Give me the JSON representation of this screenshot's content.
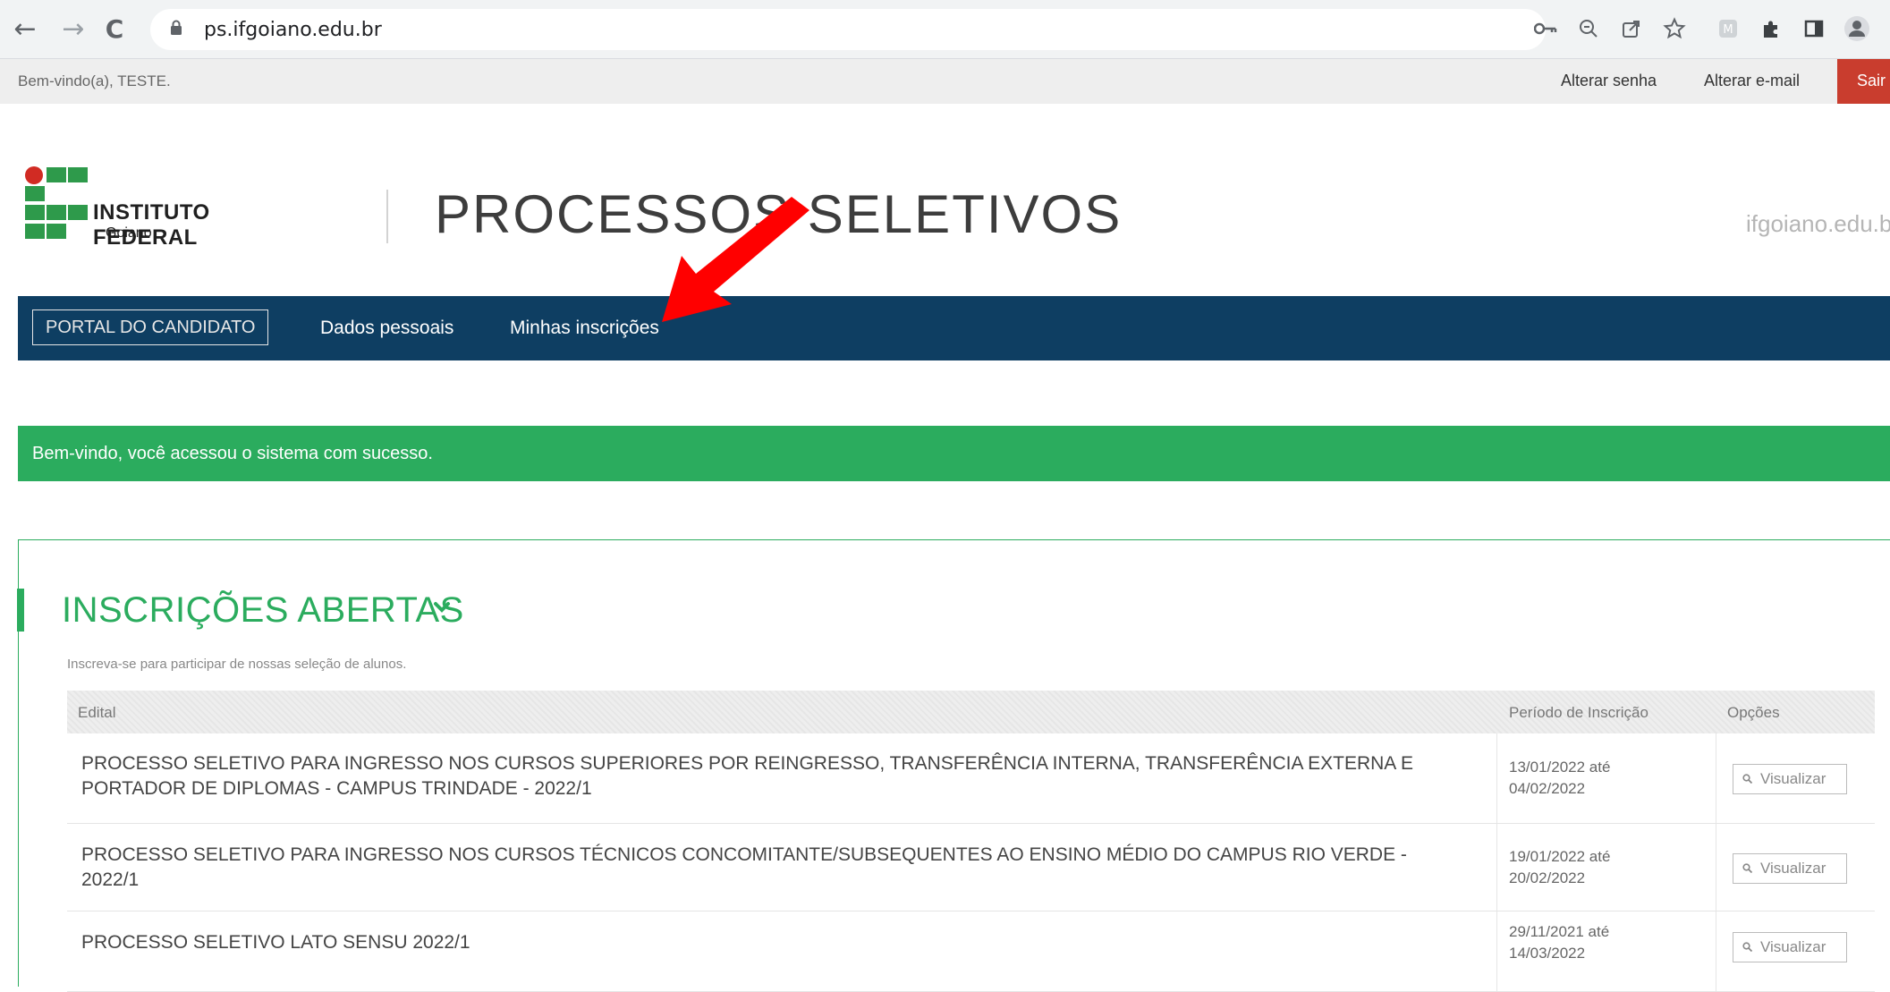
{
  "browser": {
    "url": "ps.ifgoiano.edu.br",
    "back_icon": "←",
    "forward_icon": "→",
    "reload_icon": "C",
    "icons": [
      "key-icon",
      "zoom-icon",
      "share-icon",
      "star-icon",
      "extension-m-icon",
      "puzzle-icon",
      "sidepanel-icon",
      "profile-icon"
    ]
  },
  "userbar": {
    "welcome": "Bem-vindo(a), TESTE.",
    "change_password": "Alterar senha",
    "change_email": "Alterar e-mail",
    "logout": "Sair"
  },
  "header": {
    "logo_name": "INSTITUTO FEDERAL",
    "logo_sub": "Goiano",
    "title": "PROCESSOS SELETIVOS",
    "domain": "ifgoiano.edu.b"
  },
  "nav": {
    "portal": "PORTAL DO CANDIDATO",
    "personal_data": "Dados pessoais",
    "my_registrations": "Minhas inscrições"
  },
  "alert": {
    "message": "Bem-vindo, você acessou o sistema com sucesso."
  },
  "panel": {
    "title": "INSCRIÇÕES ABERTAS",
    "subtitle": "Inscreva-se para participar de nossas seleção de alunos.",
    "columns": {
      "edital": "Edital",
      "periodo": "Período de Inscrição",
      "opcoes": "Opções"
    },
    "rows": [
      {
        "edital_line1": "PROCESSO SELETIVO PARA INGRESSO NOS CURSOS SUPERIORES POR REINGRESSO, TRANSFERÊNCIA INTERNA, TRANSFERÊNCIA EXTERNA E",
        "edital_line2": "PORTADOR DE DIPLOMAS - CAMPUS TRINDADE - 2022/1",
        "period_line1": "13/01/2022 até",
        "period_line2": "04/02/2022",
        "action": "Visualizar"
      },
      {
        "edital_line1": "PROCESSO SELETIVO PARA INGRESSO NOS CURSOS TÉCNICOS CONCOMITANTE/SUBSEQUENTES AO ENSINO MÉDIO DO CAMPUS RIO VERDE -",
        "edital_line2": "2022/1",
        "period_line1": "19/01/2022 até",
        "period_line2": "20/02/2022",
        "action": "Visualizar"
      },
      {
        "edital_line1": "PROCESSO SELETIVO LATO SENSU 2022/1",
        "edital_line2": "",
        "period_line1": "29/11/2021 até",
        "period_line2": "14/03/2022",
        "action": "Visualizar"
      }
    ]
  },
  "colors": {
    "nav_bg": "#0e3e62",
    "success_green": "#2bac5e",
    "logout_red": "#c93d2e",
    "arrow_red": "#ff0000"
  }
}
